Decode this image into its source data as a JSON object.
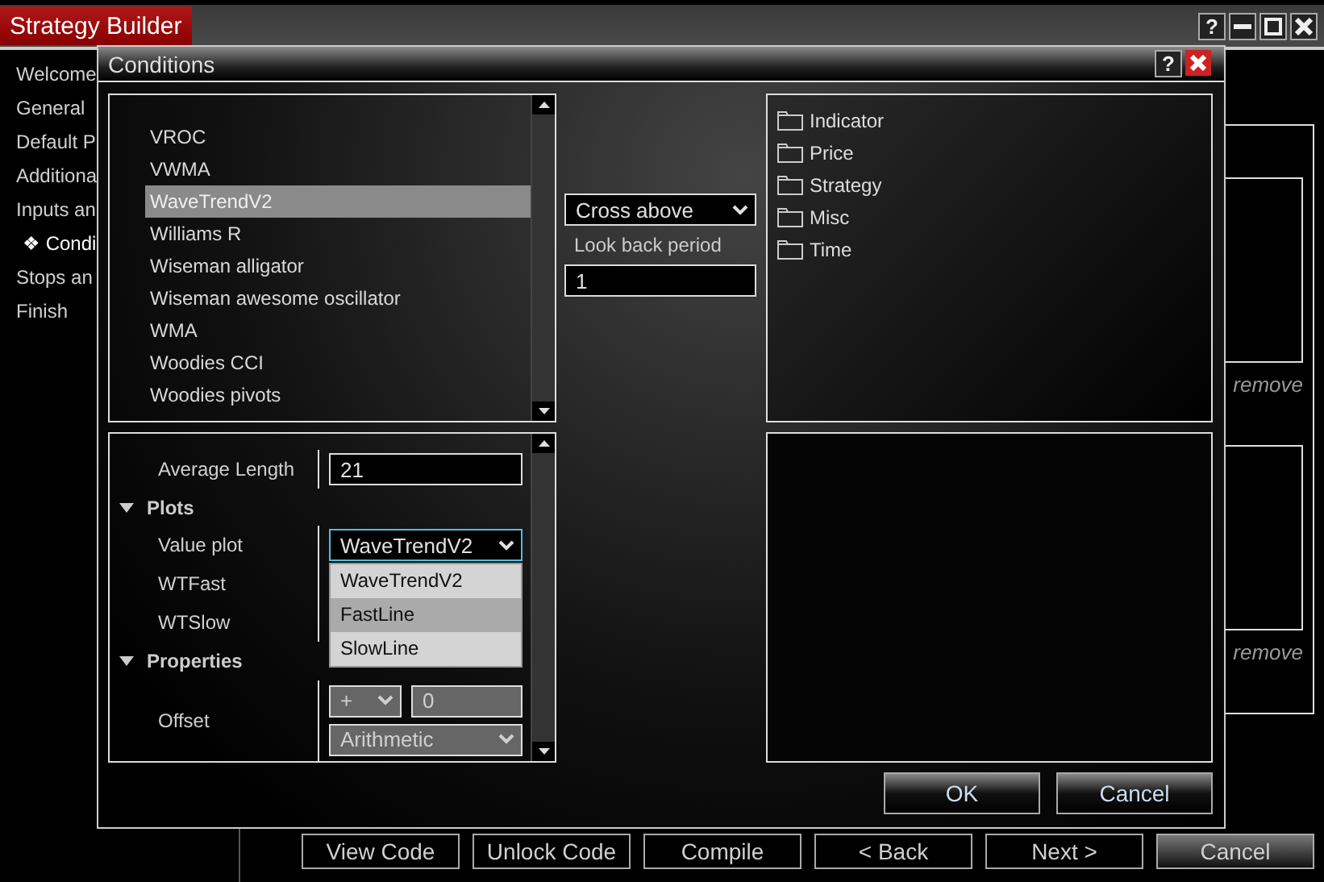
{
  "app": {
    "title": "Strategy Builder",
    "help": "?"
  },
  "sidebar": {
    "items": [
      {
        "label": "Welcome",
        "selected": false
      },
      {
        "label": "General",
        "selected": false
      },
      {
        "label": "Default P",
        "selected": false
      },
      {
        "label": "Additiona",
        "selected": false
      },
      {
        "label": "Inputs an",
        "selected": false
      },
      {
        "label": "❖ Condi",
        "selected": true
      },
      {
        "label": "Stops an",
        "selected": false
      },
      {
        "label": "Finish",
        "selected": false
      }
    ]
  },
  "background_panel": {
    "remove_links": [
      "remove",
      "remove"
    ]
  },
  "footer_buttons": [
    "View Code",
    "Unlock Code",
    "Compile",
    "< Back",
    "Next >",
    "Cancel"
  ],
  "dialog": {
    "title": "Conditions",
    "help": "?",
    "indicator_list": [
      {
        "label": "VROC",
        "selected": false
      },
      {
        "label": "VWMA",
        "selected": false
      },
      {
        "label": "WaveTrendV2",
        "selected": true
      },
      {
        "label": "Williams R",
        "selected": false
      },
      {
        "label": "Wiseman alligator",
        "selected": false
      },
      {
        "label": "Wiseman awesome oscillator",
        "selected": false
      },
      {
        "label": "WMA",
        "selected": false
      },
      {
        "label": "Woodies CCI",
        "selected": false
      },
      {
        "label": "Woodies pivots",
        "selected": false
      }
    ],
    "properties": [
      {
        "kind": "input",
        "label": "Average Length",
        "value": "21"
      },
      {
        "kind": "section",
        "label": "Plots",
        "expanded": true
      },
      {
        "kind": "select",
        "label": "Value plot",
        "value": "WaveTrendV2",
        "open": true,
        "options": [
          {
            "label": "WaveTrendV2",
            "highlighted": false
          },
          {
            "label": "FastLine",
            "highlighted": true
          },
          {
            "label": "SlowLine",
            "highlighted": false
          }
        ]
      },
      {
        "kind": "blank",
        "label": "WTFast"
      },
      {
        "kind": "blank",
        "label": "WTSlow"
      },
      {
        "kind": "section",
        "label": "Properties",
        "expanded": true
      },
      {
        "kind": "offset",
        "label": "Offset",
        "sign": "+",
        "value": "0",
        "mode": "Arithmetic",
        "disabled": true
      }
    ],
    "operator": {
      "value": "Cross above"
    },
    "look_back": {
      "label": "Look back period",
      "value": "1"
    },
    "categories": [
      "Indicator",
      "Price",
      "Strategy",
      "Misc",
      "Time"
    ],
    "buttons": [
      "OK",
      "Cancel"
    ]
  }
}
